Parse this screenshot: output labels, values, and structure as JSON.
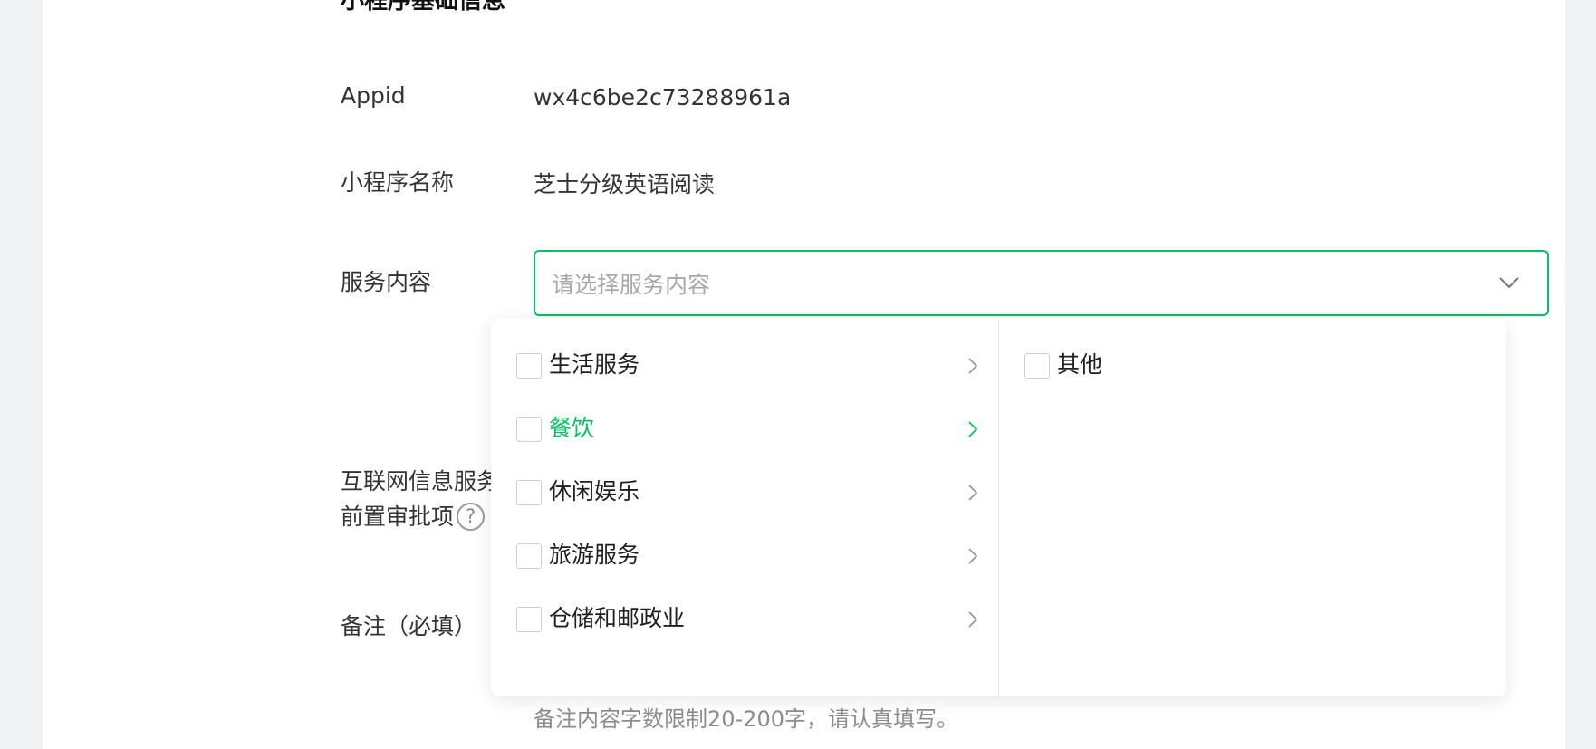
{
  "section": {
    "title": "小程序基础信息"
  },
  "fields": {
    "appid": {
      "label": "Appid",
      "value": "wx4c6be2c73288961a"
    },
    "name": {
      "label": "小程序名称",
      "value": "芝士分级英语阅读"
    },
    "service": {
      "label": "服务内容",
      "placeholder": "请选择服务内容"
    },
    "approval": {
      "label_line1": "互联网信息服务",
      "label_line2": "前置审批项",
      "help_glyph": "?"
    },
    "remark": {
      "label": "备注（必填）",
      "hint": "备注内容字数限制20-200字，请认真填写。"
    }
  },
  "dropdown": {
    "categories": [
      {
        "label": "生活服务",
        "active": false
      },
      {
        "label": "餐饮",
        "active": true
      },
      {
        "label": "休闲娱乐",
        "active": false
      },
      {
        "label": "旅游服务",
        "active": false
      },
      {
        "label": "仓储和邮政业",
        "active": false
      }
    ],
    "subcategories": [
      {
        "label": "其他"
      }
    ]
  },
  "colors": {
    "accent": "#07c160",
    "text": "#1f1f1f",
    "muted": "#8c8c8c",
    "placeholder": "#a8a8a8",
    "background": "#f2f3f5"
  },
  "icons": {
    "select_arrow": "chevron-down-icon",
    "category_arrow": "chevron-right-icon",
    "help": "question-circle-icon"
  }
}
